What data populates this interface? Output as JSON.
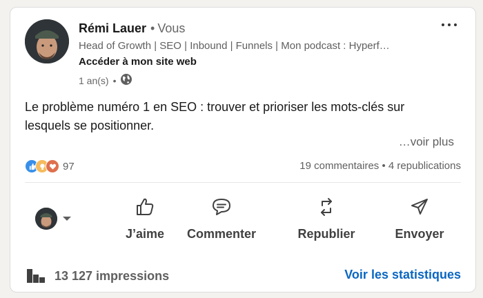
{
  "author": {
    "name": "Rémi Lauer",
    "separator": "•",
    "relation": "Vous",
    "headline": "Head of Growth | SEO | Inbound | Funnels | Mon podcast : Hyperf…",
    "cta": "Accéder à mon site web",
    "time": "1 an(s)",
    "meta_separator": "•",
    "visibility_icon": "globe-icon"
  },
  "post": {
    "text": "Le problème numéro 1 en SEO : trouver et prioriser les mots-clés sur lesquels se positionner.",
    "see_more": "…voir plus"
  },
  "reactions": {
    "icons": [
      "like-icon",
      "insightful-icon",
      "love-icon"
    ],
    "count": "97"
  },
  "social": {
    "comments": "19 commentaires",
    "separator": "•",
    "reposts": "4 republications"
  },
  "actions": {
    "like": "J’aime",
    "comment": "Commenter",
    "repost": "Republier",
    "send": "Envoyer"
  },
  "footer": {
    "impressions": "13 127 impressions",
    "stats_link": "Voir les statistiques"
  },
  "colors": {
    "link": "#0a66c2",
    "like": "#378fe9",
    "insightful": "#f5bb5c",
    "love": "#df704d"
  }
}
